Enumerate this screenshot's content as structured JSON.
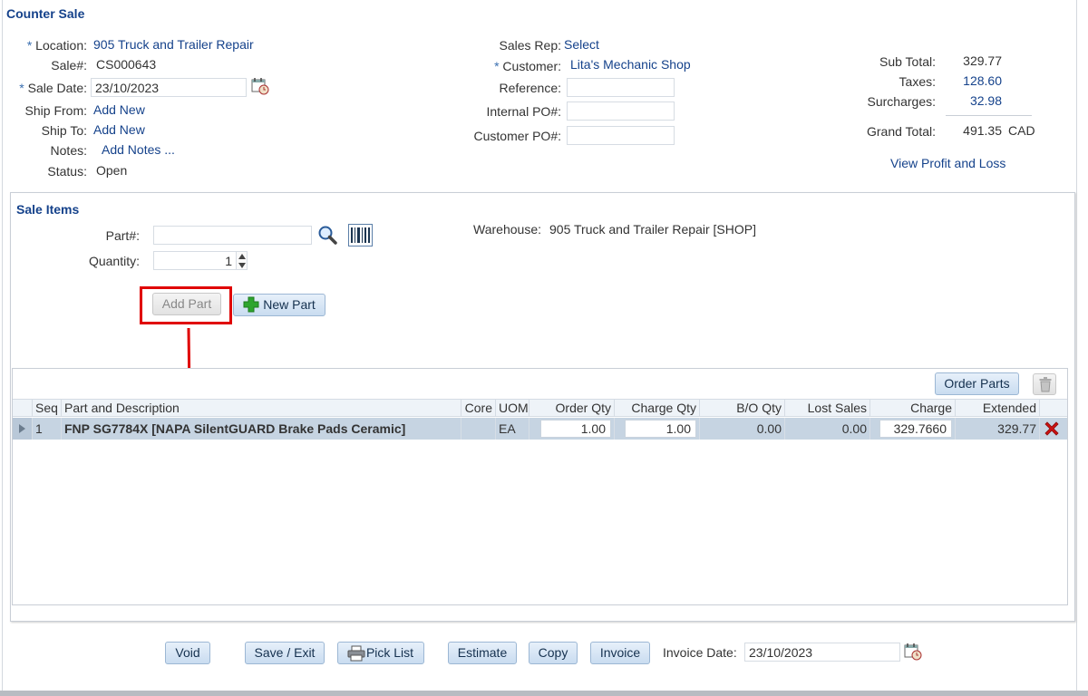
{
  "header": {
    "title": "Counter Sale"
  },
  "sale": {
    "location_label": "Location:",
    "location_value": "905 Truck and Trailer Repair",
    "sale_no_label": "Sale#:",
    "sale_no_value": "CS000643",
    "sale_date_label": "Sale Date:",
    "sale_date_value": "23/10/2023",
    "ship_from_label": "Ship From:",
    "ship_from_value": "Add New",
    "ship_to_label": "Ship To:",
    "ship_to_value": "Add New",
    "notes_label": "Notes:",
    "notes_value": "Add Notes ...",
    "status_label": "Status:",
    "status_value": "Open",
    "required_mark": "*"
  },
  "customer": {
    "sales_rep_label": "Sales Rep:",
    "sales_rep_value": "Select",
    "customer_label": "Customer:",
    "customer_value": "Lita's Mechanic Shop",
    "reference_label": "Reference:",
    "reference_value": "",
    "internal_po_label": "Internal PO#:",
    "internal_po_value": "",
    "customer_po_label": "Customer PO#:",
    "customer_po_value": ""
  },
  "totals": {
    "subtotal_label": "Sub Total:",
    "subtotal_value": "329.77",
    "taxes_label": "Taxes:",
    "taxes_value": "128.60",
    "surcharges_label": "Surcharges:",
    "surcharges_value": "32.98",
    "grand_total_label": "Grand Total:",
    "grand_total_value": "491.35",
    "currency": "CAD",
    "profit_link": "View Profit and Loss"
  },
  "sale_items": {
    "title": "Sale Items",
    "part_label": "Part#:",
    "part_value": "",
    "quantity_label": "Quantity:",
    "quantity_value": "1",
    "warehouse_label": "Warehouse:",
    "warehouse_value": "905 Truck and Trailer Repair [SHOP]",
    "add_part_label": "Add Part",
    "new_part_label": "New Part",
    "order_parts_label": "Order Parts"
  },
  "grid": {
    "columns": [
      "Seq",
      "Part and Description",
      "Core",
      "UOM",
      "Order Qty",
      "Charge Qty",
      "B/O Qty",
      "Lost Sales",
      "Charge",
      "Extended"
    ],
    "rows": [
      {
        "seq": "1",
        "part": "FNP SG7784X [NAPA SilentGUARD Brake Pads Ceramic]",
        "core": "",
        "uom": "EA",
        "order_qty": "1.00",
        "charge_qty": "1.00",
        "bo_qty": "0.00",
        "lost_sales": "0.00",
        "charge": "329.7660",
        "extended": "329.77"
      }
    ]
  },
  "footer": {
    "void_label": "Void",
    "save_exit_label": "Save / Exit",
    "pick_list_label": "Pick List",
    "estimate_label": "Estimate",
    "copy_label": "Copy",
    "invoice_label": "Invoice",
    "invoice_date_label": "Invoice Date:",
    "invoice_date_value": "23/10/2023"
  },
  "colors": {
    "link": "#15428b",
    "highlight": "#e00000",
    "row_selected": "#c6d4e2",
    "add_icon": "#2ea52e",
    "delete_icon": "#cc1111"
  },
  "icons": {
    "calendar": "calendar-clock-icon",
    "search": "magnifier-icon",
    "barcode": "barcode-icon",
    "add": "green-plus-icon",
    "printer": "printer-icon",
    "trash": "trash-icon",
    "delete": "red-x-icon",
    "row_expand": "triangle-right-icon"
  }
}
